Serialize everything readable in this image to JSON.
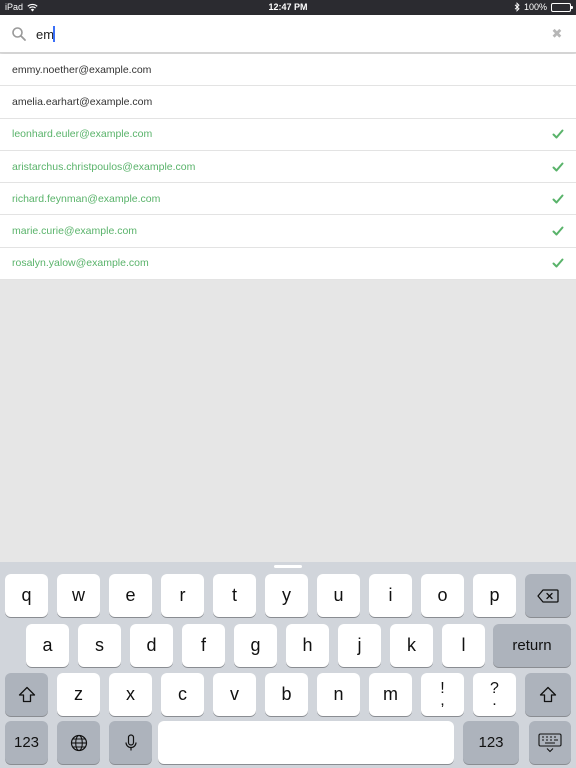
{
  "status_bar": {
    "device": "iPad",
    "time": "12:47 PM",
    "battery": "100%",
    "icons": [
      "wifi-icon",
      "bluetooth-icon",
      "battery-icon"
    ]
  },
  "search": {
    "value": "em",
    "icon": "search-icon",
    "clear_icon": "close-icon"
  },
  "emails": [
    {
      "address": "emmy.noether@example.com",
      "selected": false
    },
    {
      "address": "amelia.earhart@example.com",
      "selected": false
    },
    {
      "address": "leonhard.euler@example.com",
      "selected": true
    },
    {
      "address": "aristarchus.christpoulos@example.com",
      "selected": true
    },
    {
      "address": "richard.feynman@example.com",
      "selected": true
    },
    {
      "address": "marie.curie@example.com",
      "selected": true
    },
    {
      "address": "rosalyn.yalow@example.com",
      "selected": true
    }
  ],
  "colors": {
    "selected_text": "#59b36a",
    "status_bar_bg": "#2b2b30",
    "keyboard_bg": "#d1d5db",
    "caret": "#3b6ff7"
  },
  "keyboard": {
    "row1": [
      "q",
      "w",
      "e",
      "r",
      "t",
      "y",
      "u",
      "i",
      "o",
      "p"
    ],
    "row2": [
      "a",
      "s",
      "d",
      "f",
      "g",
      "h",
      "j",
      "k",
      "l"
    ],
    "row3": [
      "z",
      "x",
      "c",
      "v",
      "b",
      "n",
      "m"
    ],
    "return_label": "return",
    "numbers_label": "123",
    "exclaim_top": "!",
    "exclaim_bottom": ",",
    "question_top": "?",
    "question_bottom": ".",
    "icons": [
      "backspace-icon",
      "shift-icon",
      "globe-icon",
      "microphone-icon",
      "keyboard-dismiss-icon"
    ]
  }
}
